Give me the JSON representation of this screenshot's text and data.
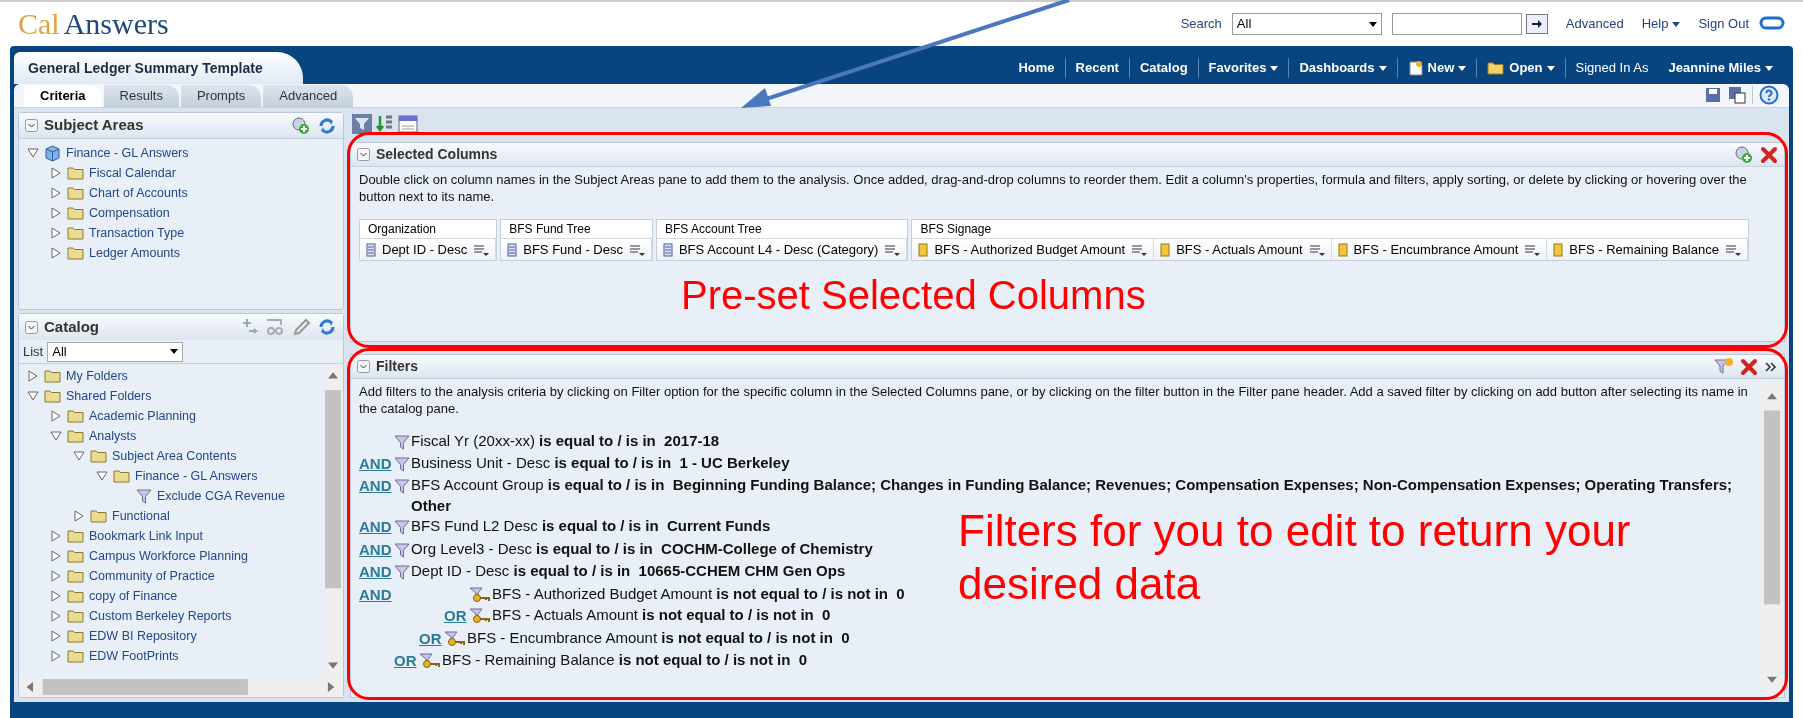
{
  "logo": {
    "first": "Cal",
    "second": "Answers"
  },
  "search": {
    "label": "Search",
    "scope": "All",
    "links": [
      {
        "label": "Advanced",
        "menu": false
      },
      {
        "label": "Help",
        "menu": true
      },
      {
        "label": "Sign Out",
        "menu": false
      }
    ]
  },
  "analysis_title": "General Ledger Summary Template",
  "nav": [
    {
      "label": "Home",
      "kind": "link",
      "menu": false
    },
    {
      "label": "Recent",
      "kind": "link",
      "menu": false
    },
    {
      "label": "Catalog",
      "kind": "link",
      "menu": false
    },
    {
      "label": "Favorites",
      "kind": "link",
      "menu": true
    },
    {
      "label": "Dashboards",
      "kind": "link",
      "menu": true
    },
    {
      "label": "New",
      "kind": "new",
      "menu": true
    },
    {
      "label": "Open",
      "kind": "open",
      "menu": true
    },
    {
      "label": "Signed In As",
      "kind": "text",
      "menu": false
    },
    {
      "label": "Jeannine Miles",
      "kind": "user",
      "menu": true
    }
  ],
  "tabs": [
    {
      "label": "Criteria",
      "selected": true
    },
    {
      "label": "Results",
      "selected": false
    },
    {
      "label": "Prompts",
      "selected": false
    },
    {
      "label": "Advanced",
      "selected": false
    }
  ],
  "subject_areas": {
    "title": "Subject Areas",
    "tree": [
      {
        "label": "Finance - GL Answers",
        "kind": "subject_area",
        "expanded": true,
        "children": [
          {
            "label": "Fiscal Calendar",
            "kind": "folder",
            "expanded": false
          },
          {
            "label": "Chart of Accounts",
            "kind": "folder",
            "expanded": false
          },
          {
            "label": "Compensation",
            "kind": "folder",
            "expanded": false
          },
          {
            "label": "Transaction Type",
            "kind": "folder",
            "expanded": false
          },
          {
            "label": "Ledger Amounts",
            "kind": "folder",
            "expanded": false
          }
        ]
      }
    ]
  },
  "catalog": {
    "title": "Catalog",
    "list_label": "List",
    "list_value": "All",
    "tree": [
      {
        "label": "My Folders",
        "kind": "folder",
        "expanded": false
      },
      {
        "label": "Shared Folders",
        "kind": "folder",
        "expanded": true,
        "children": [
          {
            "label": "Academic Planning",
            "kind": "folder",
            "expanded": false
          },
          {
            "label": "Analysts",
            "kind": "folder",
            "expanded": true,
            "children": [
              {
                "label": "Subject Area Contents",
                "kind": "folder",
                "expanded": true,
                "children": [
                  {
                    "label": "Finance - GL Answers",
                    "kind": "folder",
                    "expanded": true,
                    "children": [
                      {
                        "label": "Exclude CGA Revenue",
                        "kind": "filter"
                      }
                    ]
                  }
                ]
              },
              {
                "label": "Functional",
                "kind": "folder",
                "expanded": false
              }
            ]
          },
          {
            "label": "Bookmark Link Input",
            "kind": "folder",
            "expanded": false
          },
          {
            "label": "Campus Workforce Planning",
            "kind": "folder",
            "expanded": false
          },
          {
            "label": "Community of Practice",
            "kind": "folder",
            "expanded": false
          },
          {
            "label": "copy of Finance",
            "kind": "folder",
            "expanded": false
          },
          {
            "label": "Custom Berkeley Reports",
            "kind": "folder",
            "expanded": false
          },
          {
            "label": "EDW BI Repository",
            "kind": "folder",
            "expanded": false
          },
          {
            "label": "EDW FootPrints",
            "kind": "folder",
            "expanded": false
          }
        ]
      }
    ]
  },
  "selected_columns": {
    "title": "Selected Columns",
    "description": "Double click on column names in the Subject Areas pane to add them to the analysis. Once added, drag-and-drop columns to reorder them. Edit a column's properties, formula and filters, apply sorting, or delete by clicking or hovering over the button next to its name.",
    "groups": [
      {
        "label": "Organization",
        "columns": [
          {
            "label": "Dept ID - Desc",
            "kind": "attribute"
          }
        ]
      },
      {
        "label": "BFS Fund Tree",
        "columns": [
          {
            "label": "BFS Fund - Desc",
            "kind": "attribute"
          }
        ]
      },
      {
        "label": "BFS Account Tree",
        "columns": [
          {
            "label": "BFS Account L4 - Desc (Category)",
            "kind": "attribute"
          }
        ]
      },
      {
        "label": "BFS Signage",
        "columns": [
          {
            "label": "BFS - Authorized Budget Amount",
            "kind": "measure"
          },
          {
            "label": "BFS - Actuals Amount",
            "kind": "measure"
          },
          {
            "label": "BFS - Encumbrance Amount",
            "kind": "measure"
          },
          {
            "label": "BFS - Remaining Balance",
            "kind": "measure"
          }
        ]
      }
    ],
    "annotation": "Pre-set Selected Columns"
  },
  "filters": {
    "title": "Filters",
    "description": "Add filters to the analysis criteria by clicking on Filter option for the specific column in the Selected Columns pane, or by clicking on the filter button in the Filter pane header. Add a saved filter by clicking on add button after selecting its name in the catalog pane.",
    "items": [
      {
        "kind": "filter",
        "text": "Fiscal Yr (20xx-xx) **is equal to / is in  2017-18**"
      },
      {
        "kind": "filter",
        "connector": "AND",
        "text": "Business Unit - Desc **is equal to / is in  1 - UC Berkeley**"
      },
      {
        "kind": "filter",
        "connector": "AND",
        "text": "BFS Account Group **is equal to / is in  Beginning Funding Balance; Changes in Funding Balance; Revenues; Compensation Expenses; Non-Compensation Expenses; Operating Transfers; Other**"
      },
      {
        "kind": "filter",
        "connector": "AND",
        "text": "BFS Fund L2 Desc **is equal to / is in  Current Funds**"
      },
      {
        "kind": "filter",
        "connector": "AND",
        "text": "Org Level3 - Desc **is equal to / is in  COCHM-College of Chemistry**"
      },
      {
        "kind": "filter",
        "connector": "AND",
        "text": "Dept ID - Desc **is equal to / is in  10665-CCHEM CHM Gen Ops**"
      },
      {
        "kind": "group",
        "connector": "AND",
        "children": [
          {
            "kind": "group",
            "children": [
              {
                "kind": "group",
                "children": [
                  {
                    "kind": "measure_filter",
                    "text": "BFS - Authorized Budget Amount **is not equal to / is not in  0**"
                  },
                  {
                    "kind": "measure_filter",
                    "connector": "OR",
                    "text": "BFS - Actuals Amount **is not equal to / is not in  0**"
                  }
                ]
              },
              {
                "kind": "measure_filter",
                "connector": "OR",
                "text": "BFS - Encumbrance Amount **is not equal to / is not in  0**"
              }
            ]
          },
          {
            "kind": "measure_filter",
            "connector": "OR",
            "text": "BFS - Remaining Balance **is not equal to / is not in  0**"
          }
        ]
      }
    ],
    "annotation": "Filters for you to edit to return your desired data"
  }
}
